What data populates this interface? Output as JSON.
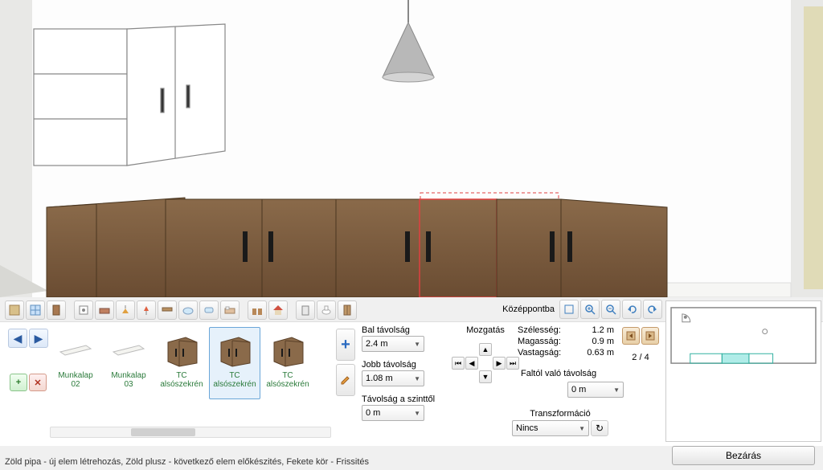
{
  "toolbar": {
    "center_label": "Középpontba"
  },
  "thumbs": [
    {
      "label_l1": "Munkalap",
      "label_l2": "02",
      "type": "flat"
    },
    {
      "label_l1": "Munkalap",
      "label_l2": "03",
      "type": "flat"
    },
    {
      "label_l1": "TC",
      "label_l2": "alsószekrén",
      "type": "cab"
    },
    {
      "label_l1": "TC",
      "label_l2": "alsószekrén",
      "type": "cab",
      "selected": true
    },
    {
      "label_l1": "TC",
      "label_l2": "alsószekrén",
      "type": "cab"
    }
  ],
  "params": {
    "bal_label": "Bal távolság",
    "bal_value": "2.4 m",
    "jobb_label": "Jobb távolság",
    "jobb_value": "1.08 m",
    "szint_label": "Távolság a szinttől",
    "szint_value": "0 m"
  },
  "move": {
    "title": "Mozgatás"
  },
  "dims": {
    "w_label": "Szélesség:",
    "w_value": "1.2 m",
    "h_label": "Magasság:",
    "h_value": "0.9 m",
    "d_label": "Vastagság:",
    "d_value": "0.63 m"
  },
  "wall_dist": {
    "label": "Faltól való távolság",
    "value": "0 m"
  },
  "transform": {
    "label": "Transzformáció",
    "value": "Nincs"
  },
  "pager": {
    "text": "2 / 4"
  },
  "status": "Zöld pipa - új elem létrehozás, Zöld plusz - következő elem előkészités, Fekete kör - Frissités",
  "close": "Bezárás"
}
